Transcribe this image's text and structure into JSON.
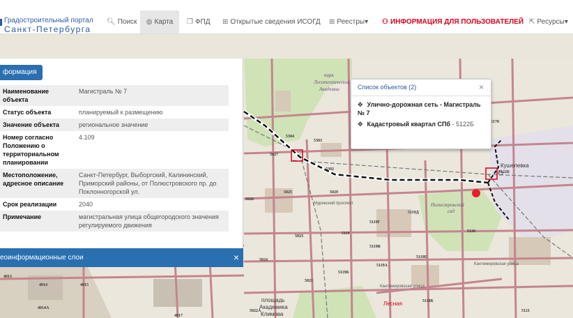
{
  "header": {
    "brand_line1": "Градостроительный портал",
    "brand_line2": "Санкт-Петербурга",
    "nav": [
      {
        "id": "search",
        "icon": "🔍︎",
        "label": "Поиск"
      },
      {
        "id": "map",
        "icon": "◍",
        "label": "Карта"
      },
      {
        "id": "fpd",
        "icon": "❐",
        "label": "ФПД"
      },
      {
        "id": "isogd",
        "icon": "⊞",
        "label": "Открытые сведения ИСОГД"
      },
      {
        "id": "registries",
        "icon": "⊞",
        "label": "Реестры▾"
      },
      {
        "id": "info",
        "icon": "⚇",
        "label": "ИНФОРМАЦИЯ ДЛЯ ПОЛЬЗОВАТЕЛЕЙ"
      },
      {
        "id": "resources",
        "icon": "⇱",
        "label": "Ресурсы▾"
      }
    ]
  },
  "info_panel": {
    "button_label": "формация",
    "rows": [
      {
        "key": "Наименование объекта",
        "value": "Магистраль № 7"
      },
      {
        "key": "Статус объекта",
        "value": "планируемый к размещению"
      },
      {
        "key": "Значение объекта",
        "value": "региональное значение"
      },
      {
        "key": "Номер согласно Положению о территориальном планировании",
        "value": "4.109"
      },
      {
        "key": "Местоположение, адресное описание",
        "value": "Санкт-Петербург, Выборгский, Калининский, Приморский районы, от Полюстровского пр. до Поклонногорской ул."
      },
      {
        "key": "Срок реализации",
        "value": "2040"
      },
      {
        "key": "Примечание",
        "value": "магистральная улица общегородского значения регулируемого движения"
      }
    ]
  },
  "geo_layers": {
    "label": "еоинформационные слои",
    "close": "×"
  },
  "popup": {
    "title": "Список объектов (2)",
    "close": "×",
    "item1": "Улично-дорожная сеть - Магистраль № 7",
    "item2_bold": "Кадастровый квартал СПб",
    "item2_rest": " - 5122Б",
    "move_icon": "✥"
  },
  "map_labels": {
    "park": [
      "парк",
      "Лесотехнической",
      "Академии"
    ],
    "station": "Кушелевка",
    "garden": [
      "Полюстровский",
      "сад"
    ],
    "lesnaya": "Лесная",
    "plaza": [
      "площадь",
      "Академика",
      "Климова"
    ],
    "street1": "Муринский проспект",
    "street2": "Кантемировская улица",
    "street3": "Кантемировская улица",
    "blocks": [
      "5304",
      "5303",
      "5027",
      "5302",
      "5025",
      "5029",
      "5026",
      "5023",
      "5119",
      "5119Г",
      "5119Д",
      "5120",
      "5119В",
      "5119Б",
      "5119А",
      "5119Е",
      "5021",
      "5024",
      "5118Б",
      "5022А",
      "5121",
      "4011",
      "4013",
      "4014",
      "4015",
      "4014А",
      "4017",
      "5122Б",
      "5170"
    ]
  }
}
